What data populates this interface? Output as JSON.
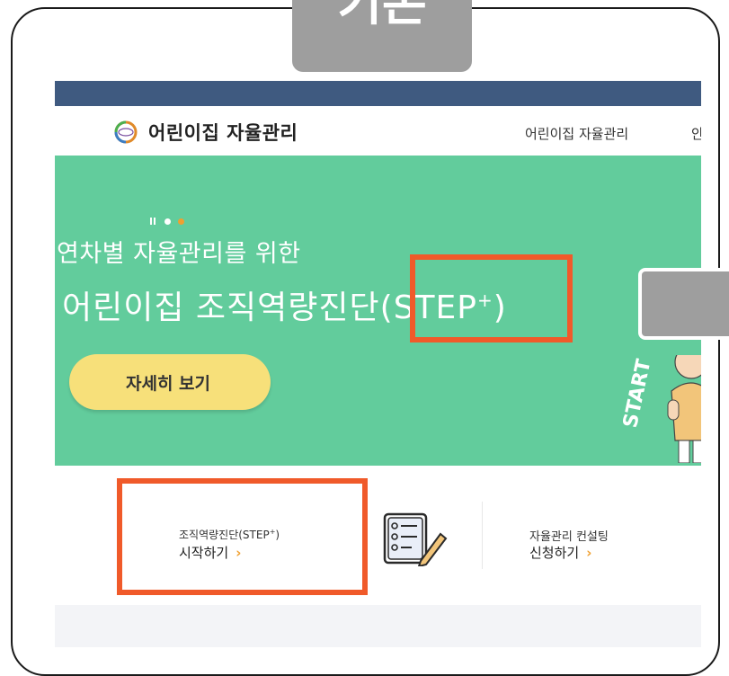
{
  "overlay": {
    "title_tab": "기존"
  },
  "site": {
    "name": "어린이집 자율관리",
    "nav": [
      "어린이집 자율관리",
      "안"
    ]
  },
  "hero": {
    "subtitle": "연차별 자율관리를 위한",
    "title_main": "어린이집 조직역량진단(STEP",
    "title_sup": "+",
    "title_end": ")",
    "button_label": "자세히 보기",
    "side_text": "START",
    "background": "#62cc9c"
  },
  "shortcuts": [
    {
      "line1_main": "조직역량진단(STEP",
      "line1_sup": "+",
      "line1_end": ")",
      "line2": "시작하기",
      "arrow": "›"
    },
    {
      "line1": "자율관리 컨설팅",
      "line2": "신청하기",
      "arrow": "›"
    }
  ],
  "colors": {
    "highlight": "#f05a2a",
    "topbar": "#3f5a80",
    "button": "#f7e07a",
    "accent_arrow": "#f0a030"
  }
}
